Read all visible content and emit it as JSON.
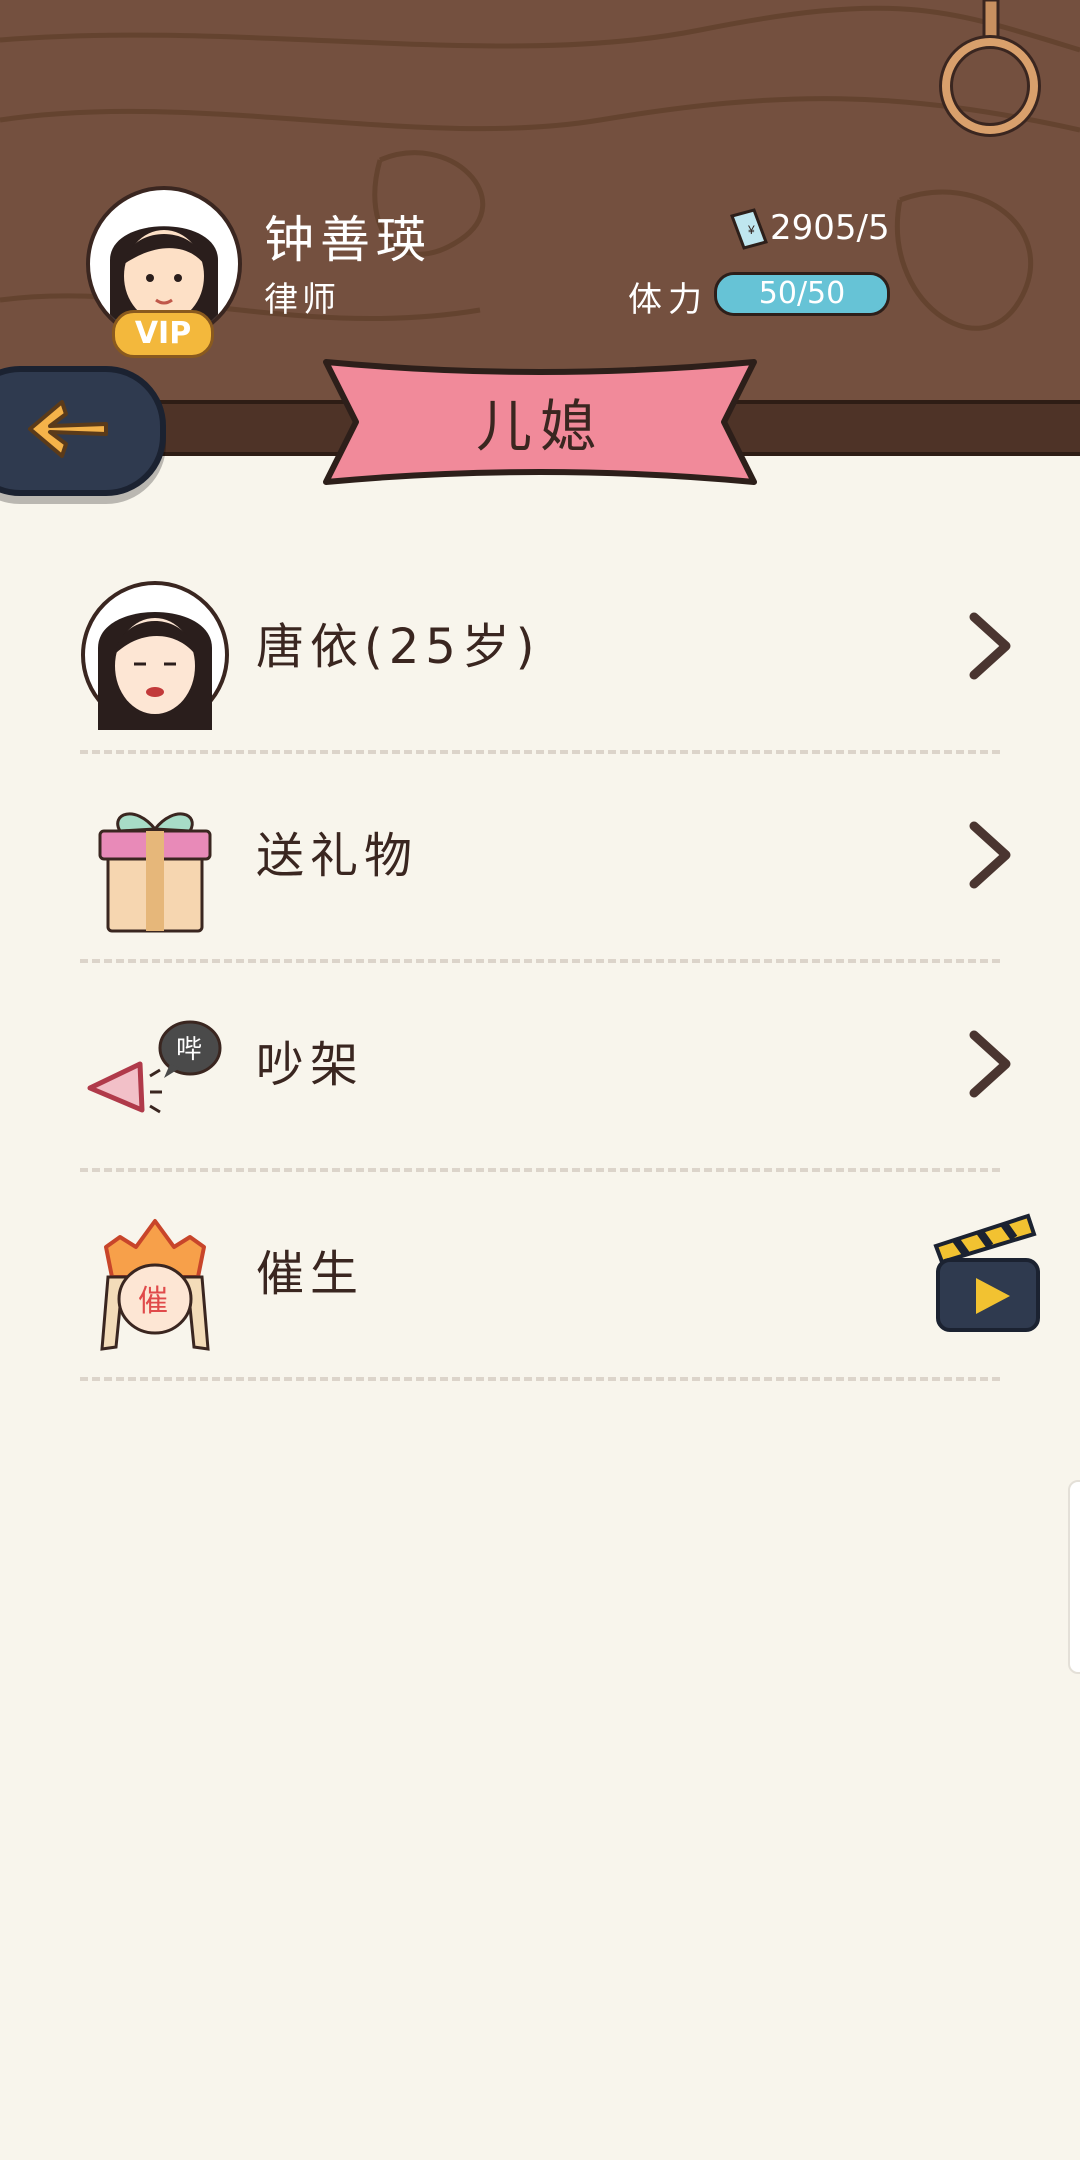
{
  "player": {
    "name": "钟善瑛",
    "job": "律师",
    "vip_label": "VIP",
    "money": "2905/5",
    "stamina_label": "体力",
    "stamina_text": "50/50",
    "stamina_fraction": 1.0
  },
  "page": {
    "title": "儿媳"
  },
  "list": {
    "items": [
      {
        "label": "唐依(25岁)",
        "icon": "daughter-in-law-avatar-icon",
        "action": "chevron-right-icon"
      },
      {
        "label": "送礼物",
        "icon": "gift-icon",
        "action": "chevron-right-icon"
      },
      {
        "label": "吵架",
        "icon": "megaphone-icon",
        "action": "chevron-right-icon"
      },
      {
        "label": "催生",
        "icon": "urge-baby-icon",
        "action": "video-ad-icon"
      }
    ]
  },
  "icons": {
    "megaphone_bubble_text": "哔",
    "urge_icon_text": "催"
  },
  "colors": {
    "wood": "#74503f",
    "background": "#f8f5ec",
    "ribbon": "#f18a9a",
    "stamina": "#66c3d6",
    "vip": "#f3b83c",
    "back_button": "#2f3a4f"
  }
}
